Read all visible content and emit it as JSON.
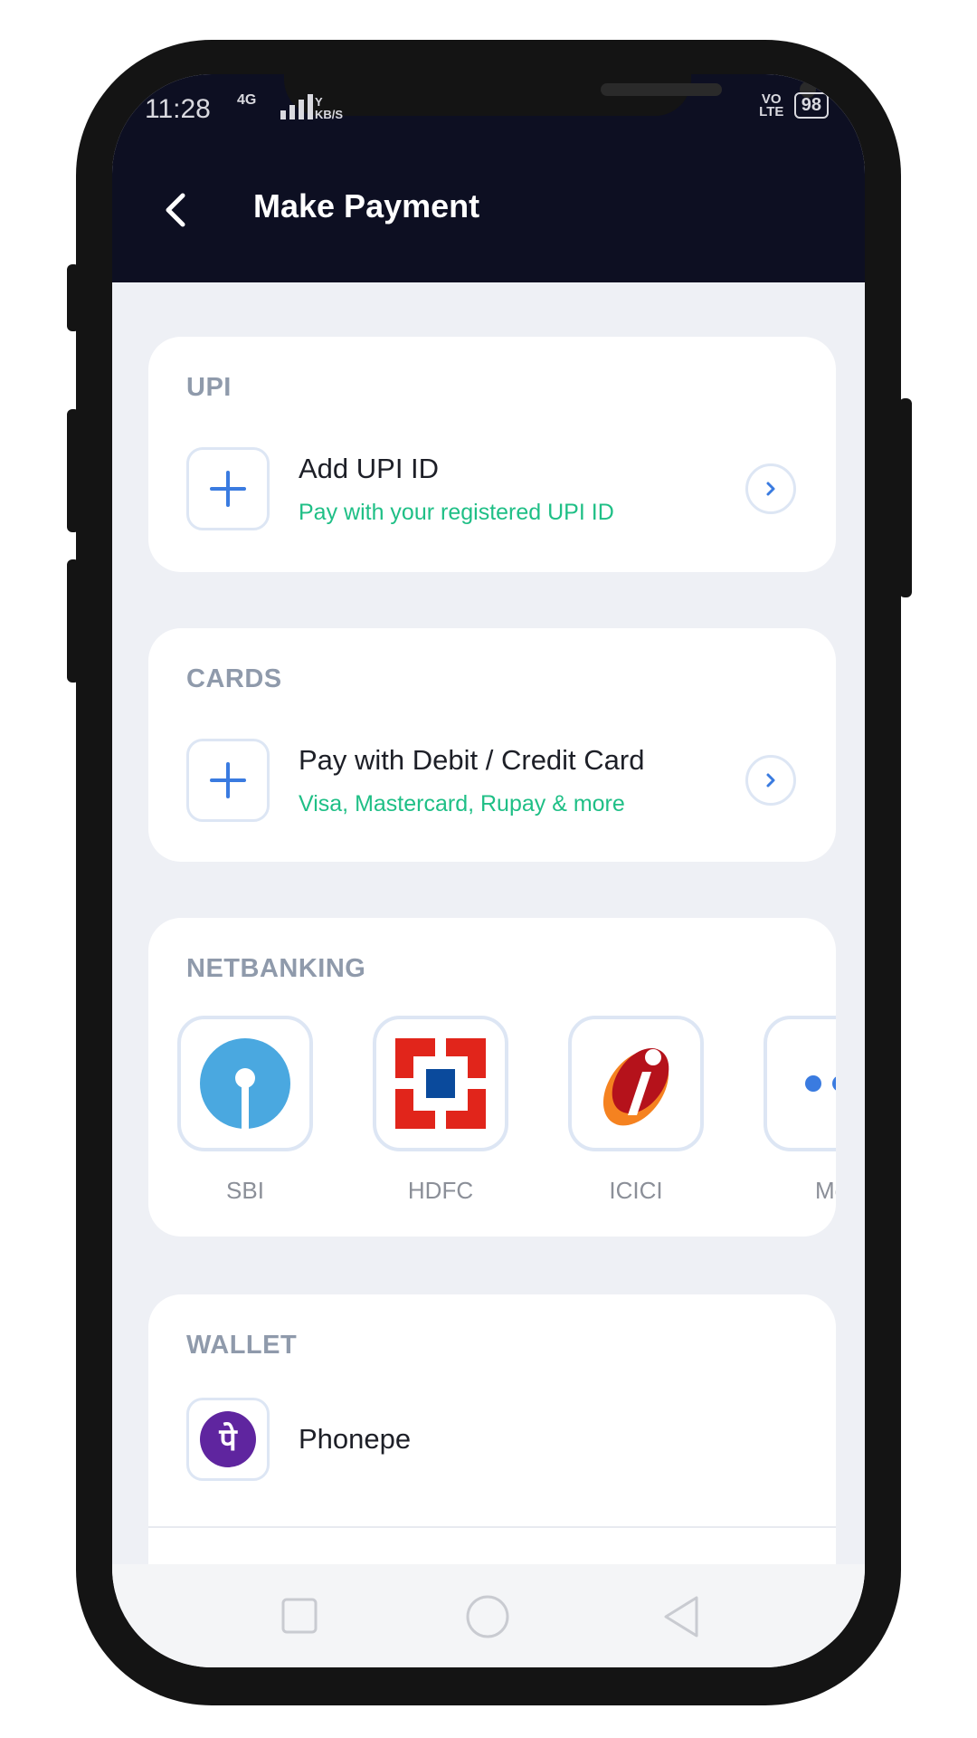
{
  "status_bar": {
    "time": "11:28",
    "network": "4G",
    "speed": "Y KB/S",
    "volte": "VO LTE",
    "battery": "98"
  },
  "header": {
    "title": "Make Payment"
  },
  "upi": {
    "section_title": "UPI",
    "title": "Add UPI ID",
    "subtitle": "Pay with your registered UPI ID"
  },
  "cards": {
    "section_title": "CARDS",
    "title": "Pay with Debit / Credit Card",
    "subtitle": "Visa, Mastercard, Rupay & more"
  },
  "netbanking": {
    "section_title": "NETBANKING",
    "banks": [
      {
        "label": "SBI",
        "icon": "sbi-logo-icon"
      },
      {
        "label": "HDFC",
        "icon": "hdfc-logo-icon"
      },
      {
        "label": "ICICI",
        "icon": "icici-logo-icon"
      },
      {
        "label": "Mo",
        "icon": "more-icon"
      }
    ]
  },
  "wallet": {
    "section_title": "WALLET",
    "items": [
      {
        "label": "Phonepe",
        "icon": "phonepe-logo-icon",
        "glyph": "पे"
      }
    ]
  },
  "colors": {
    "header_bg": "#0d0f22",
    "accent_blue": "#3a7be0",
    "subtitle_green": "#1fbf86",
    "sbi_blue": "#4aa8e0",
    "hdfc_red": "#e1251b",
    "hdfc_blue": "#0a4a9c",
    "phonepe_purple": "#5f259f"
  },
  "nav": {
    "icons": [
      "recent-apps-icon",
      "home-icon",
      "back-triangle-icon"
    ]
  }
}
